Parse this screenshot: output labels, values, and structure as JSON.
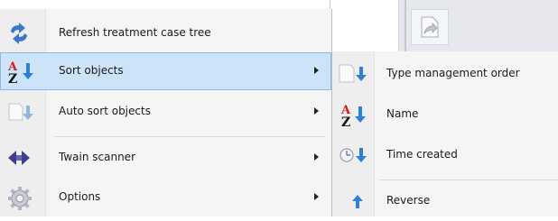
{
  "menu": {
    "items": [
      {
        "label": "Refresh treatment case tree",
        "icon": "refresh-icon",
        "has_submenu": false
      },
      {
        "label": "Sort objects",
        "icon": "sort-az-icon",
        "has_submenu": true,
        "highlighted": true
      },
      {
        "label": "Auto sort objects",
        "icon": "auto-sort-icon",
        "has_submenu": true
      },
      {
        "label": "Twain scanner",
        "icon": "scanner-icon",
        "has_submenu": true
      },
      {
        "label": "Options",
        "icon": "gear-icon",
        "has_submenu": true
      }
    ]
  },
  "submenu": {
    "items": [
      {
        "label": "Type management order",
        "icon": "type-order-icon"
      },
      {
        "label": "Name",
        "icon": "sort-name-icon"
      },
      {
        "label": "Time created",
        "icon": "clock-sort-icon"
      },
      {
        "label": "Reverse",
        "icon": "reverse-arrow-icon"
      }
    ]
  },
  "icons": {
    "sort_letters": {
      "top": "A",
      "bottom": "Z"
    }
  },
  "colors": {
    "highlight_bg": "#cde3f7",
    "highlight_border": "#8ab7e4",
    "arrow_blue": "#2f7fd6",
    "letter_red": "#d11c1c",
    "refresh_blue": "#3a78c9"
  }
}
